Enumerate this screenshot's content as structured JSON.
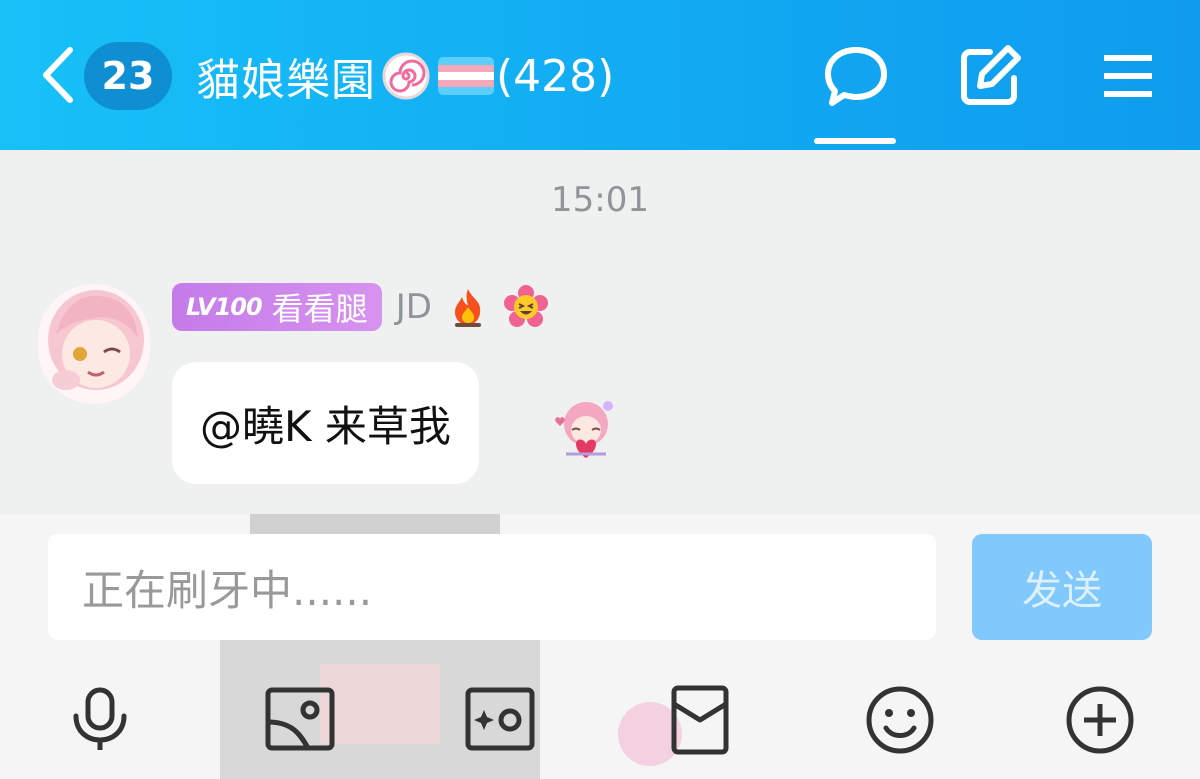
{
  "header": {
    "unread_count": "23",
    "group_name": "貓娘樂園",
    "member_count": "(428)"
  },
  "chat": {
    "timestamp": "15:01",
    "message": {
      "level": "LV100",
      "title": "看看腿",
      "sender": "JD",
      "text": "@曉K 来草我"
    }
  },
  "composer": {
    "placeholder": "正在刷牙中......",
    "send_label": "发送"
  },
  "toolbar": [
    "voice",
    "image",
    "camera",
    "red-packet",
    "emoji",
    "plus"
  ],
  "colors": {
    "header": "#12aaf2",
    "badge": "#0f8ed1",
    "send_disabled": "#80c9fa",
    "level_badge": "#c47be9"
  }
}
